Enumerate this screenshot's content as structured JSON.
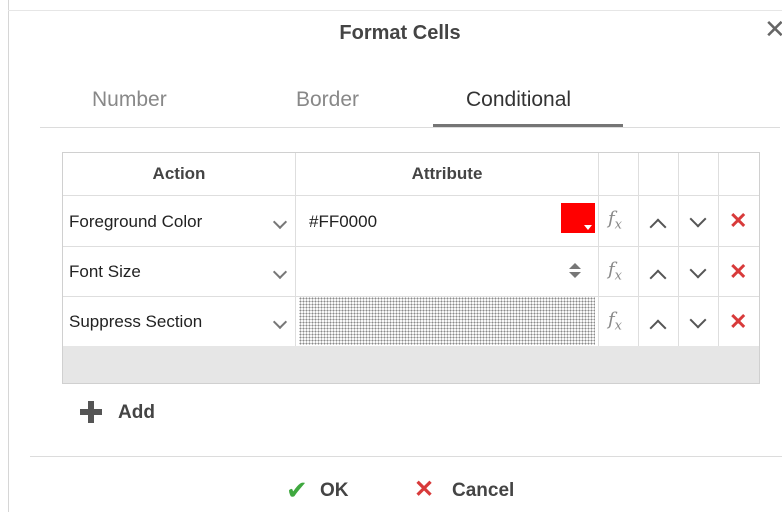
{
  "dialog": {
    "title": "Format Cells"
  },
  "tabs": [
    {
      "label": "Number"
    },
    {
      "label": "Border"
    },
    {
      "label": "Conditional",
      "active": true
    }
  ],
  "grid": {
    "headers": {
      "action": "Action",
      "attribute": "Attribute"
    },
    "rows": [
      {
        "action": "Foreground Color",
        "attribute": "#FF0000",
        "attribute_color": "#ff0000"
      },
      {
        "action": "Font Size",
        "attribute": ""
      },
      {
        "action": "Suppress Section",
        "attribute": ""
      }
    ],
    "icons": {
      "fx": "function-icon",
      "up": "move-up-icon",
      "down": "move-down-icon",
      "delete": "delete-icon"
    }
  },
  "add": {
    "label": "Add"
  },
  "buttons": {
    "ok": "OK",
    "cancel": "Cancel"
  },
  "colors": {
    "ok": "#3fa83f",
    "cancel": "#d83a3a",
    "delete": "#d83a3a"
  }
}
